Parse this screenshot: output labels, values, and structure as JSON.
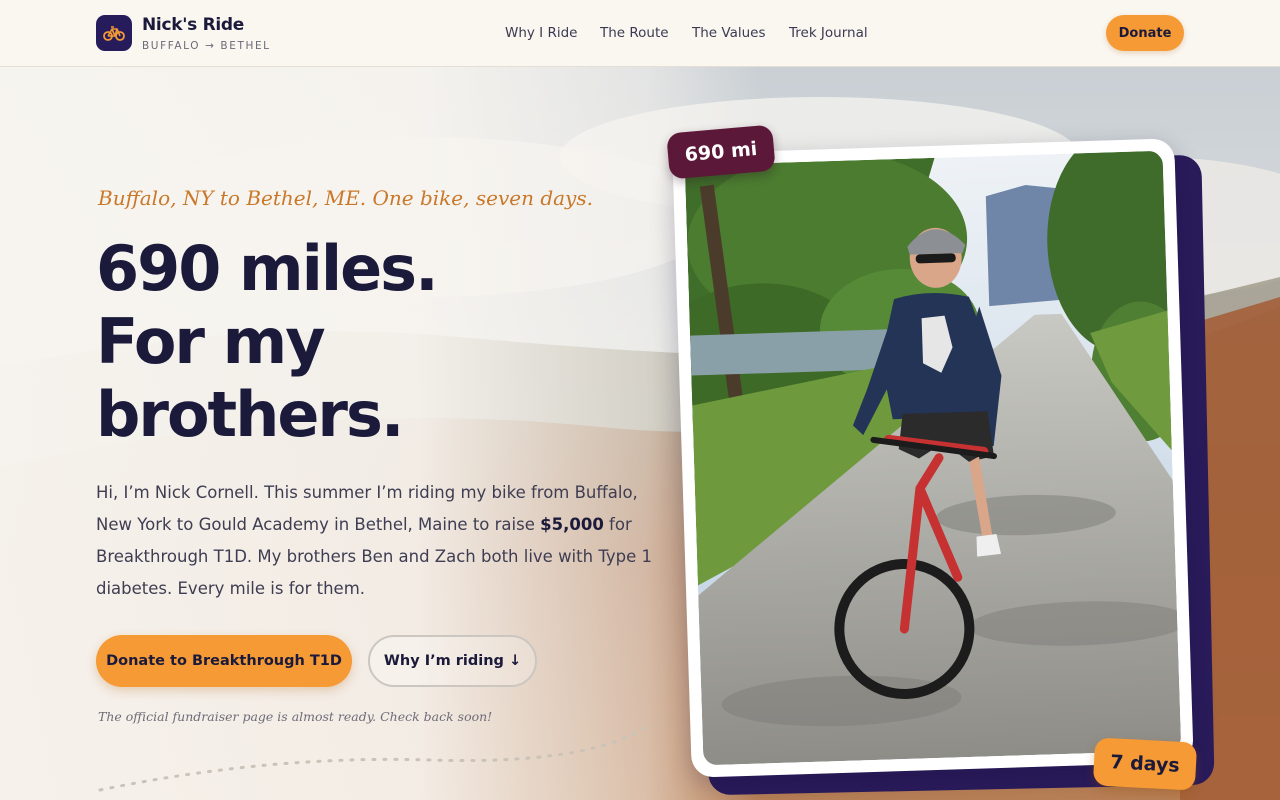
{
  "header": {
    "brand_name": "Nick's Ride",
    "brand_sub": "BUFFALO → BETHEL",
    "logo_icon": "bicycle-icon",
    "nav": [
      {
        "label": "Why I Ride"
      },
      {
        "label": "The Route"
      },
      {
        "label": "The Values"
      },
      {
        "label": "Trek Journal"
      }
    ],
    "donate_label": "Donate"
  },
  "hero": {
    "tagline": "Buffalo, NY to Bethel, ME. One bike, seven days.",
    "headline": [
      "690 miles.",
      "For my",
      "brothers."
    ],
    "intro_before": "Hi, I’m Nick Cornell. This summer I’m riding my bike from Buffalo, New York to Gould Academy in Bethel, Maine to raise ",
    "intro_amount": "$5,000",
    "intro_after": " for Breakthrough T1D. My brothers Ben and Zach both live with Type 1 diabetes. Every mile is for them.",
    "primary_button": "Donate to Breakthrough T1D",
    "secondary_button": "Why I’m riding ↓",
    "note": "The official fundraiser page is almost ready. Check back soon!"
  },
  "photo": {
    "badge_distance": "690 mi",
    "badge_duration": "7 days"
  },
  "colors": {
    "accent": "#f59a35",
    "navy": "#261c5c",
    "maroon": "#5c1838",
    "ink": "#1b1a3a"
  }
}
